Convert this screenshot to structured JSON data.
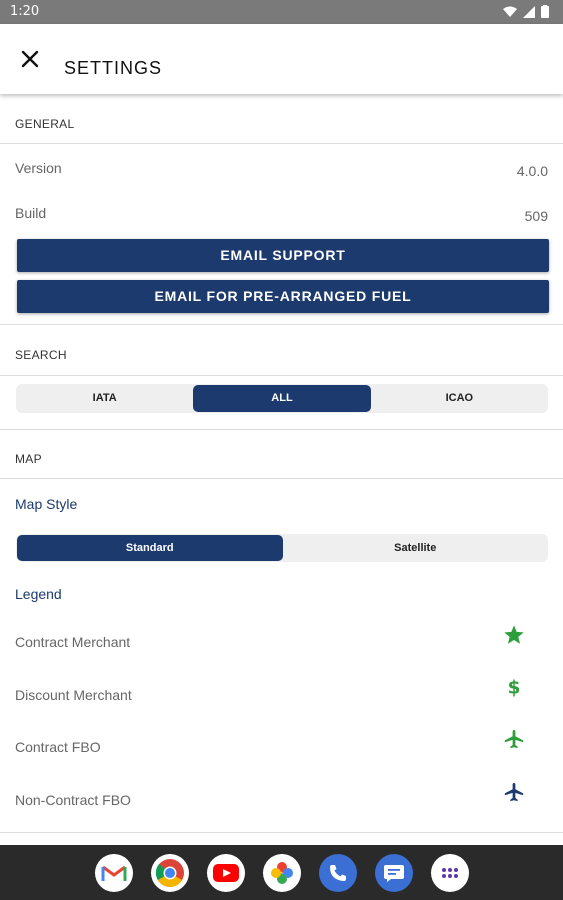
{
  "status": {
    "time": "1:20"
  },
  "appbar": {
    "title": "SETTINGS"
  },
  "general": {
    "heading": "GENERAL",
    "version_label": "Version",
    "version_value": "4.0.0",
    "build_label": "Build",
    "build_value": "509",
    "email_support": "EMAIL SUPPORT",
    "email_fuel": "EMAIL FOR PRE-ARRANGED FUEL"
  },
  "search": {
    "heading": "SEARCH",
    "options": [
      "IATA",
      "ALL",
      "ICAO"
    ],
    "selected": "ALL"
  },
  "map": {
    "heading": "MAP",
    "style_label": "Map Style",
    "style_options": [
      "Standard",
      "Satellite"
    ],
    "selected_style": "Standard",
    "legend_label": "Legend",
    "legend": [
      {
        "label": "Contract Merchant",
        "icon": "star-icon",
        "color": "#2e9e3a"
      },
      {
        "label": "Discount Merchant",
        "icon": "dollar-icon",
        "color": "#2e9e3a"
      },
      {
        "label": "Contract FBO",
        "icon": "airplane-icon",
        "color": "#2e9e3a"
      },
      {
        "label": "Non-Contract FBO",
        "icon": "airplane-icon",
        "color": "#1c3a6e"
      }
    ]
  },
  "colors": {
    "primary": "#1c3a6e",
    "green": "#2e9e3a"
  }
}
